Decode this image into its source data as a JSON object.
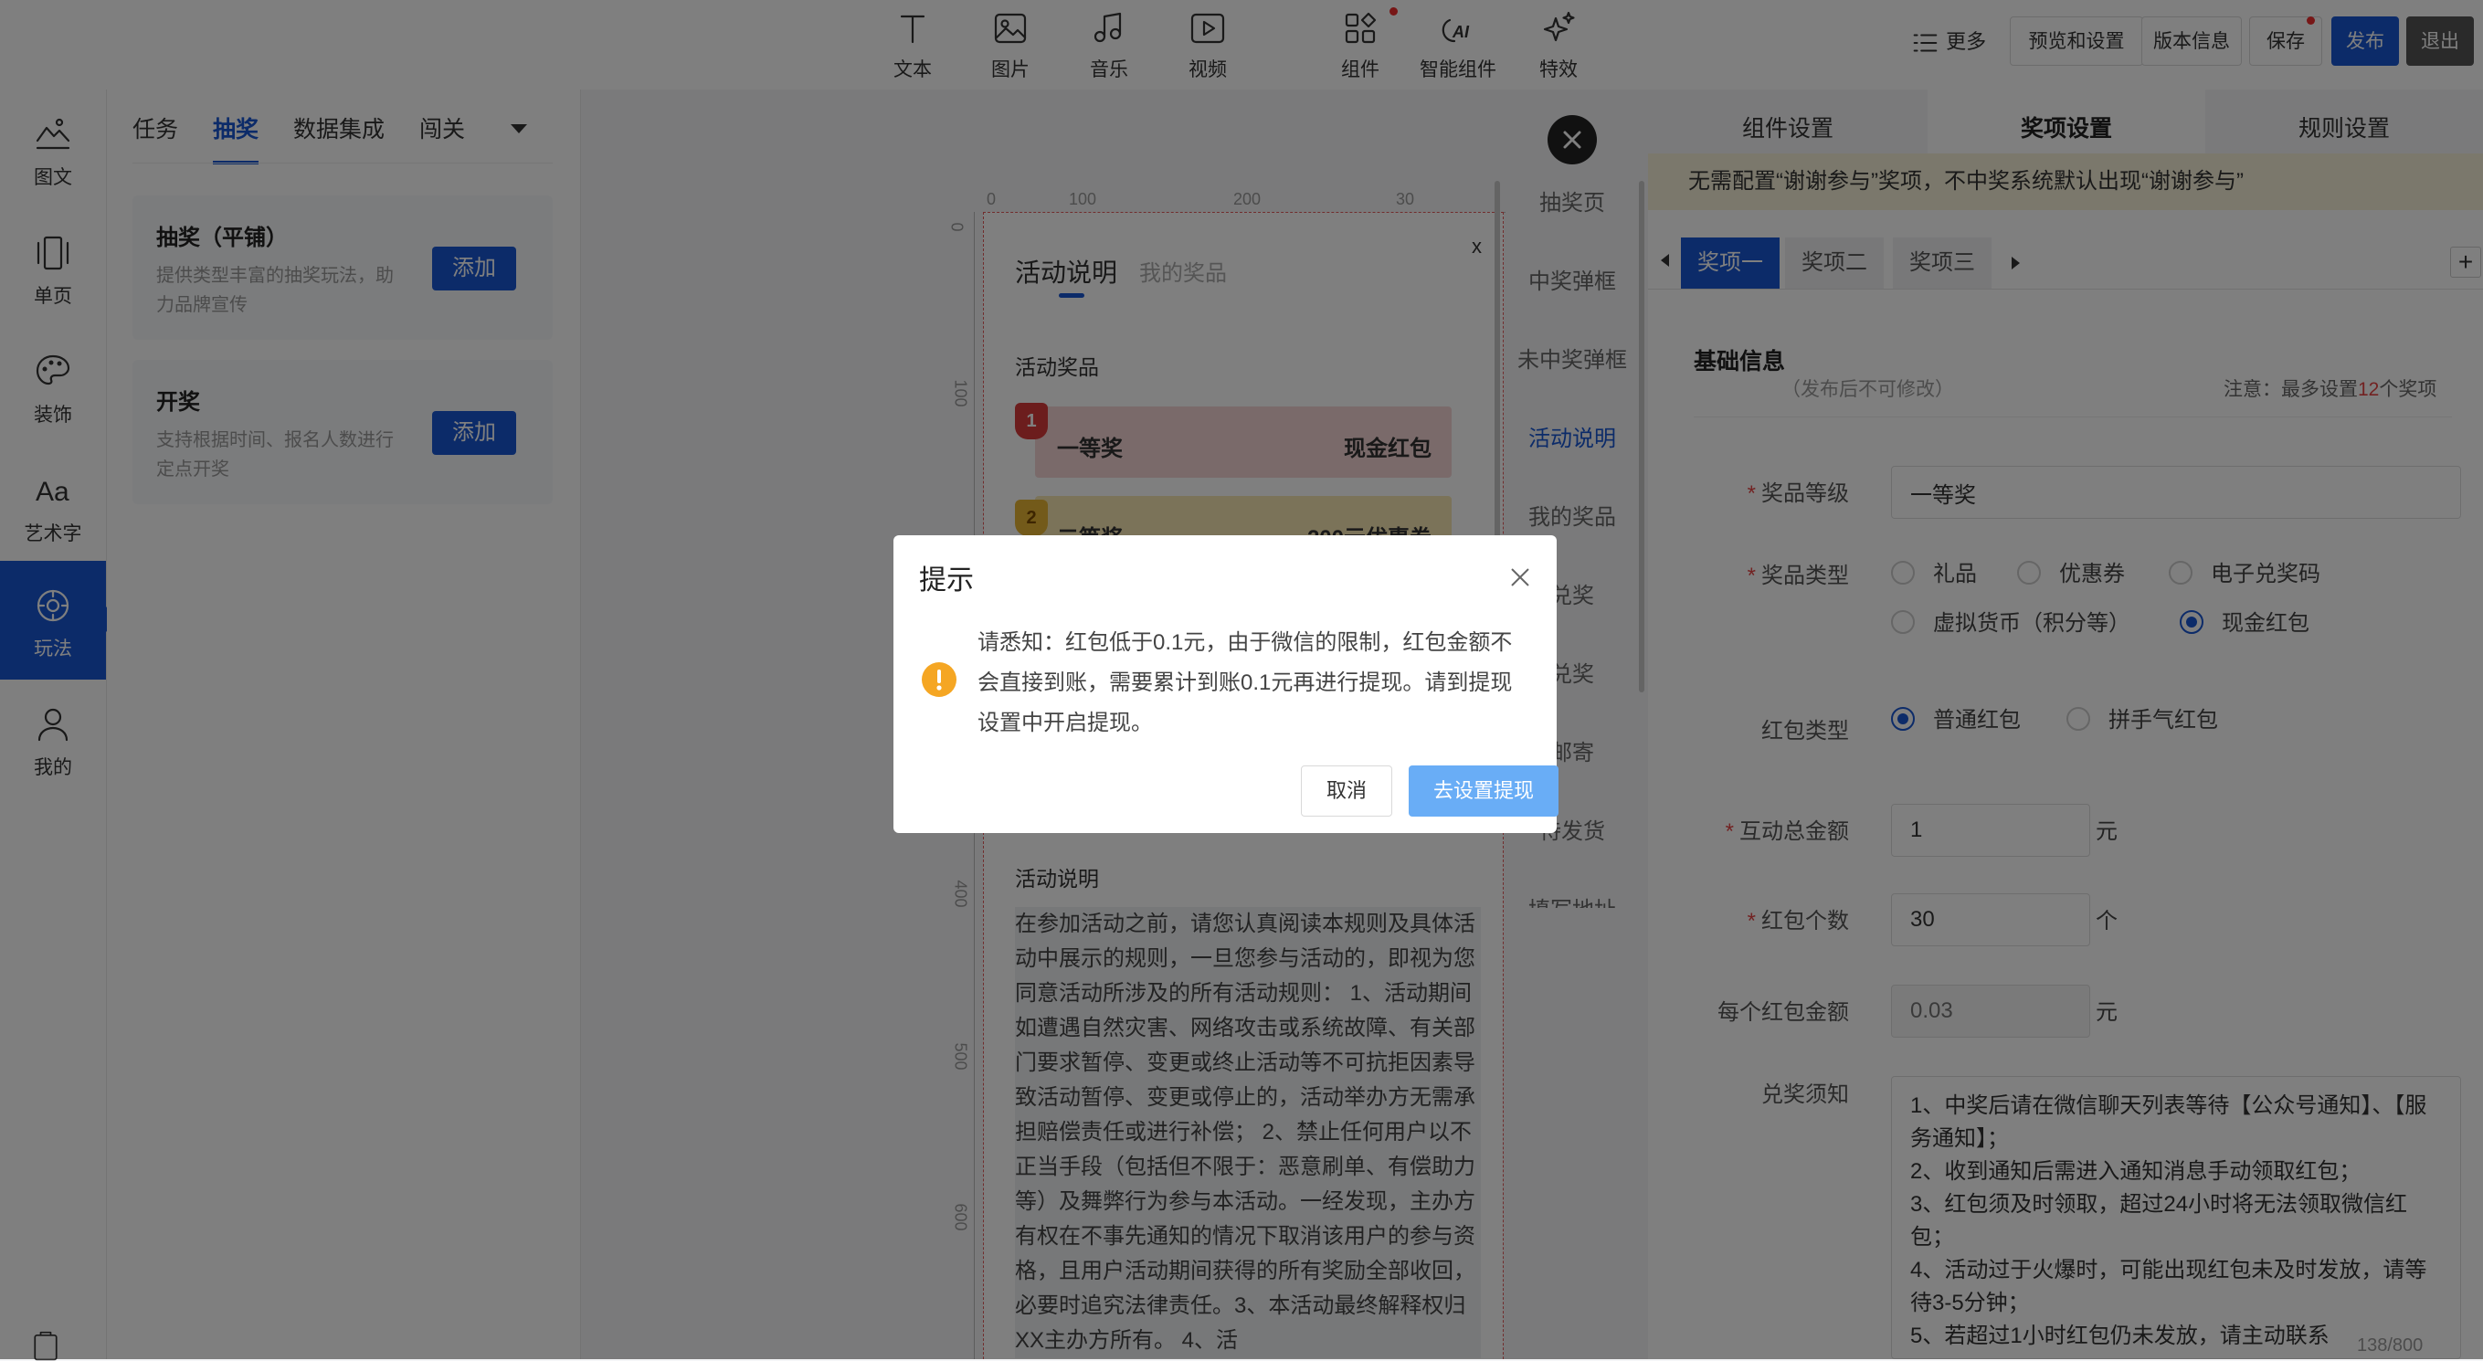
{
  "toolbar": {
    "tools": [
      {
        "label": "文本",
        "icon": "text-icon"
      },
      {
        "label": "图片",
        "icon": "image-icon"
      },
      {
        "label": "音乐",
        "icon": "music-icon"
      },
      {
        "label": "视频",
        "icon": "video-icon"
      },
      {
        "label": "组件",
        "icon": "components-icon"
      },
      {
        "label": "智能组件",
        "icon": "ai-component-icon"
      },
      {
        "label": "特效",
        "icon": "sparkle-icon"
      }
    ],
    "more_label": "更多",
    "preview_label": "预览和设置",
    "version_label": "版本信息",
    "save_label": "保存",
    "publish_label": "发布",
    "exit_label": "退出"
  },
  "leftnav": {
    "items": [
      {
        "label": "图文",
        "icon": "image-text-icon"
      },
      {
        "label": "单页",
        "icon": "single-page-icon"
      },
      {
        "label": "装饰",
        "icon": "palette-icon"
      },
      {
        "label": "艺术字",
        "icon": "art-text-icon"
      },
      {
        "label": "玩法",
        "icon": "gameplay-icon",
        "active": true
      },
      {
        "label": "我的",
        "icon": "user-icon"
      }
    ]
  },
  "panel": {
    "tabs": [
      "任务",
      "抽奖",
      "数据集成",
      "闯关"
    ],
    "active_tab": "抽奖",
    "cards": [
      {
        "title": "抽奖（平铺）",
        "desc": "提供类型丰富的抽奖玩法，助力品牌宣传",
        "button": "添加"
      },
      {
        "title": "开奖",
        "desc": "支持根据时间、报名人数进行定点开奖",
        "button": "添加"
      }
    ]
  },
  "canvas": {
    "ruler_top": [
      "0",
      "100",
      "200",
      "30"
    ],
    "ruler_left": [
      "0",
      "100",
      "400",
      "500",
      "600"
    ],
    "phone": {
      "tabs": [
        "活动说明",
        "我的奖品"
      ],
      "close": "x",
      "section_prizes": "活动奖品",
      "prizes": [
        {
          "rank": "1",
          "name": "一等奖",
          "value": "现金红包"
        },
        {
          "rank": "2",
          "name": "二等奖",
          "value": "200元优惠券"
        }
      ],
      "section_desc": "活动说明",
      "desc_text": "在参加活动之前，请您认真阅读本规则及具体活动中展示的规则，一旦您参与活动的，即视为您同意活动所涉及的所有活动规则： 1、活动期间如遭遇自然灾害、网络攻击或系统故障、有关部门要求暂停、变更或终止活动等不可抗拒因素导致活动暂停、变更或停止的，活动举办方无需承担赔偿责任或进行补偿； 2、禁止任何用户以不正当手段（包括但不限于：恶意刷单、有偿助力等）及舞弊行为参与本活动。一经发现，主办方有权在不事先通知的情况下取消该用户的参与资格，且用户活动期间获得的所有奖励全部收回，必要时追究法律责任。3、本活动最终解释权归XX主办方所有。 4、活"
    }
  },
  "pagelist": {
    "items": [
      "抽奖页",
      "中奖弹框",
      "未中奖弹框",
      "活动说明",
      "我的奖品",
      "兑奖",
      "兑奖",
      "邮寄",
      "待发货",
      "填写地址"
    ],
    "active": "活动说明"
  },
  "settings": {
    "tabs": [
      "组件设置",
      "奖项设置",
      "规则设置"
    ],
    "active_tab": "奖项设置",
    "notice": "无需配置“谢谢参与”奖项，不中奖系统默认出现“谢谢参与”",
    "prize_tabs": [
      "奖项一",
      "奖项二",
      "奖项三"
    ],
    "add_symbol": "+",
    "section_title": "基础信息",
    "section_sub": "（发布后不可修改）",
    "limit_prefix": "注意：最多设置",
    "limit_num": "12",
    "limit_suffix": "个奖项",
    "fields": {
      "level_label": "奖品等级",
      "level_value": "一等奖",
      "type_label": "奖品类型",
      "type_options": [
        "礼品",
        "优惠券",
        "电子兑奖码",
        "虚拟货币（积分等）",
        "现金红包"
      ],
      "type_selected": "现金红包",
      "redpack_label": "红包类型",
      "redpack_options": [
        "普通红包",
        "拼手气红包"
      ],
      "redpack_selected": "普通红包",
      "total_label": "互动总金额",
      "total_value": "1",
      "total_unit": "元",
      "count_label": "红包个数",
      "count_value": "30",
      "count_unit": "个",
      "each_label": "每个红包金额",
      "each_placeholder": "0.03",
      "each_unit": "元",
      "notes_label": "兑奖须知",
      "notes_lines": [
        "1、中奖后请在微信聊天列表等待【公众号通知】、【服务通知】；",
        "2、收到通知后需进入通知消息手动领取红包；",
        "3、红包须及时领取，超过24小时将无法领取微信红包；",
        "4、活动过于火爆时，可能出现红包未及时发放，请等待3-5分钟；",
        "5、若超过1小时红包仍未发放，请主动联系"
      ],
      "notes_counter": "138/800"
    }
  },
  "dialog": {
    "title": "提示",
    "message": "请悉知：红包低于0.1元，由于微信的限制，红包金额不会直接到账，需要累计到账0.1元再进行提现。请到提现设置中开启提现。",
    "cancel": "取消",
    "confirm": "去设置提现"
  },
  "colors": {
    "primary": "#1957d2",
    "confirm_button": "#69adf6",
    "warning": "#f5a623",
    "notice_bg": "#f6f1d8",
    "overlay": "rgba(0,0,0,0.5)"
  }
}
